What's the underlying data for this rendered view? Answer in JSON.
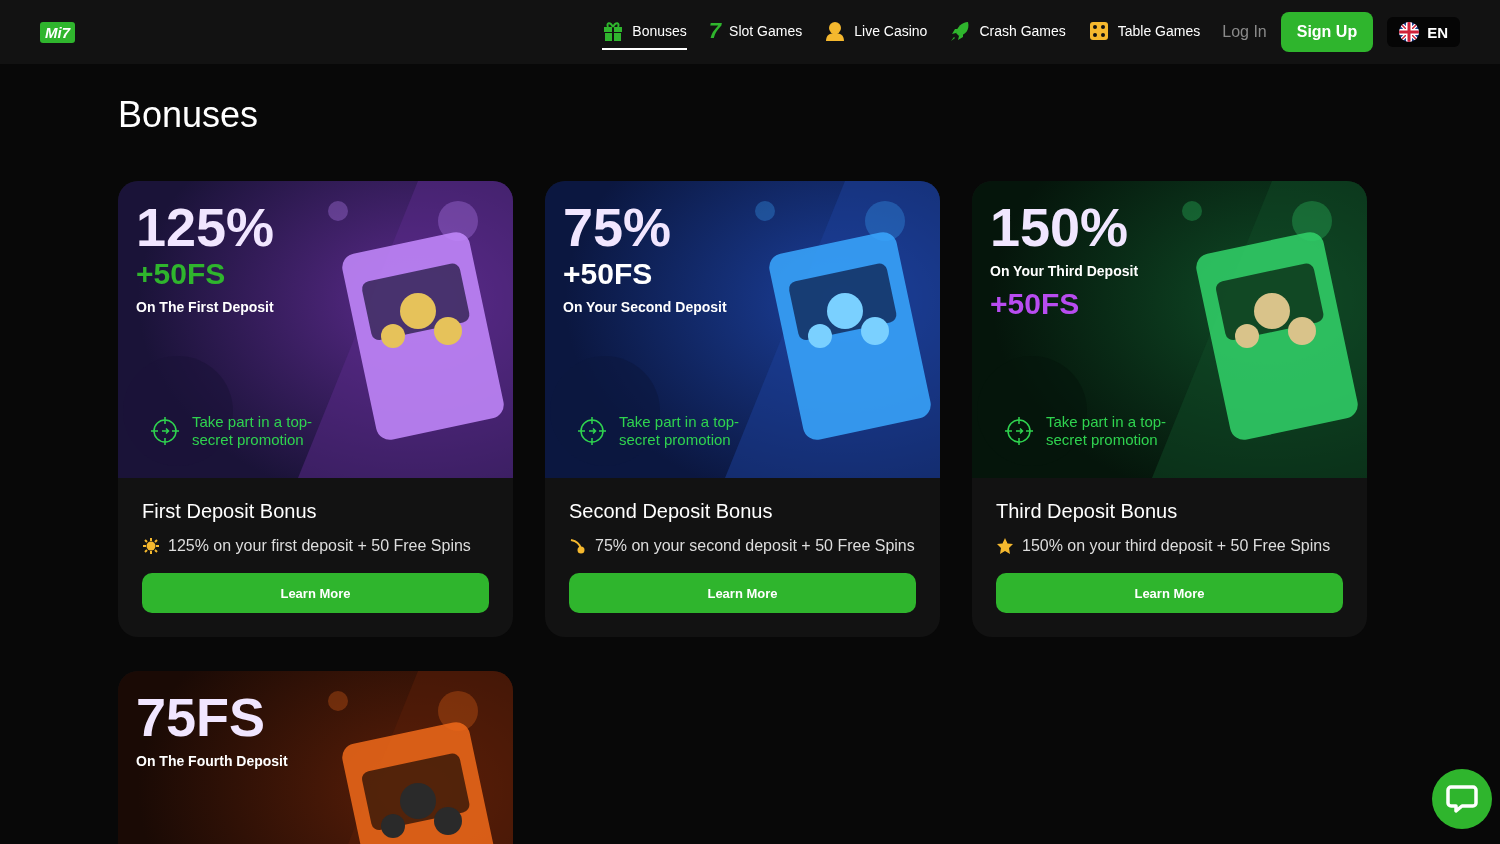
{
  "header": {
    "logo": "Mi7",
    "nav": [
      {
        "label": "Bonuses",
        "selected": true
      },
      {
        "label": "Slot Games",
        "glyph": "7",
        "selected": false
      },
      {
        "label": "Live Casino",
        "selected": false
      },
      {
        "label": "Crash Games",
        "selected": false
      },
      {
        "label": "Table Games",
        "selected": false
      }
    ],
    "login": "Log In",
    "signup": "Sign Up",
    "language": "EN"
  },
  "page_title": "Bonuses",
  "bonuses": [
    {
      "banner": {
        "lines": [
          {
            "kind": "big",
            "text": "125%"
          },
          {
            "kind": "fs",
            "text": "+50FS",
            "color": "#2fb52d"
          },
          {
            "kind": "sub",
            "text": "On The First Deposit"
          }
        ],
        "promo": "Take part in a top-secret promotion"
      },
      "title": "First Deposit Bonus",
      "description": "125% on your first deposit + 50 Free Spins",
      "button": "Learn More"
    },
    {
      "banner": {
        "lines": [
          {
            "kind": "big",
            "text": "75%"
          },
          {
            "kind": "fs",
            "text": "+50FS",
            "color": "#ffffff"
          },
          {
            "kind": "sub",
            "text": "On Your Second Deposit"
          }
        ],
        "promo": "Take part in a top-secret promotion"
      },
      "title": "Second Deposit Bonus",
      "description": "75% on your second deposit + 50 Free Spins",
      "button": "Learn More"
    },
    {
      "banner": {
        "lines": [
          {
            "kind": "big",
            "text": "150%"
          },
          {
            "kind": "sub",
            "text": "On Your Third Deposit"
          },
          {
            "kind": "fs",
            "text": "+50FS",
            "color": "#b84cf0"
          }
        ],
        "promo": "Take part in a top-secret promotion"
      },
      "title": "Third Deposit Bonus",
      "description": "150% on your third deposit + 50 Free Spins",
      "button": "Learn More"
    },
    {
      "banner": {
        "lines": [
          {
            "kind": "big",
            "text": "75FS"
          },
          {
            "kind": "sub",
            "text": "On The Fourth Deposit"
          }
        ]
      }
    }
  ]
}
